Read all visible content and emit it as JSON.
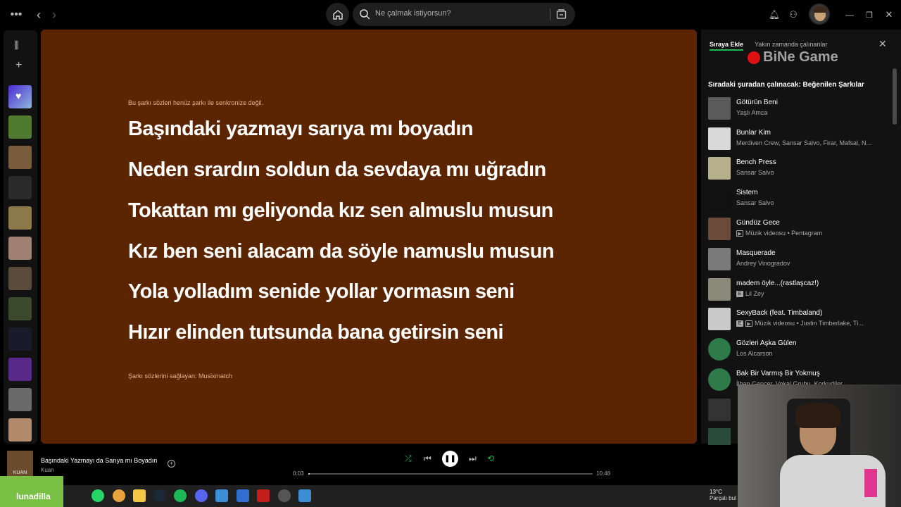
{
  "topbar": {
    "search_placeholder": "Ne çalmak istiyorsun?"
  },
  "lyrics": {
    "sync_note": "Bu şarkı sözleri henüz şarkı ile senkronize değil.",
    "lines": [
      "Başındaki yazmayı sarıya mı boyadın",
      "Neden srardın soldun da sevdaya mı uğradın",
      "Tokattan mı geliyonda kız sen almuslu musun",
      "Kız ben seni alacam da söyle namuslu musun",
      "Yola yolladım senide yollar yormasın seni",
      "Hızır elinden tutsunda bana getirsin seni"
    ],
    "provider": "Şarkı sözlerini sağlayan: Musixmatch",
    "background_color": "#5c2501"
  },
  "queue": {
    "tab_active": "Sıraya Ekle",
    "tab_recent": "Yakın zamanda çalınanlar",
    "watermark": "BiNe Game",
    "heading": "Sıradaki şuradan çalınacak: Beğenilen Şarkılar",
    "items": [
      {
        "title": "Götürün Beni",
        "subtitle": "Yaşlı Amca",
        "badge": "",
        "color": "#5a5a5a"
      },
      {
        "title": "Bunlar Kim",
        "subtitle": "Merdiven Crew, Sansar Salvo, Firar, Mafsal, N...",
        "badge": "",
        "color": "#d9d9d9"
      },
      {
        "title": "Bench Press",
        "subtitle": "Sansar Salvo",
        "badge": "",
        "color": "#b8b08a"
      },
      {
        "title": "Sistem",
        "subtitle": "Sansar Salvo",
        "badge": "",
        "color": "#111111"
      },
      {
        "title": "Gündüz Gece",
        "subtitle": "Müzik videosu • Pentagram",
        "badge": "video",
        "color": "#6b4a3a"
      },
      {
        "title": "Masquerade",
        "subtitle": "Andrey Vinogradov",
        "badge": "",
        "color": "#7a7a7a"
      },
      {
        "title": "madem öyle...(rastlaşcaz!)",
        "subtitle": "Lil Zey",
        "badge": "E",
        "color": "#8a8a7a"
      },
      {
        "title": "SexyBack (feat. Timbaland)",
        "subtitle": "Müzik videosu • Justin Timberlake, Ti...",
        "badge": "E+video",
        "color": "#c9c9c9"
      },
      {
        "title": "Gözleri Aşka Gülen",
        "subtitle": "Los Alcarson",
        "badge": "",
        "color": "#2e7a48"
      },
      {
        "title": "Bak Bir Varmış Bir Yokmuş",
        "subtitle": "İlhan Gencer, Vokal Grubu, Korkudiler...",
        "badge": "",
        "color": "#2e7a48"
      }
    ]
  },
  "player": {
    "thumb_label": "KUAN",
    "track_title": "Başındaki Yazmayı da Sarıya mı Boyadın",
    "artist": "Kuan",
    "elapsed": "0:03",
    "duration": "10:48",
    "progress": 0.005
  },
  "taskbar": {
    "overlay_name": "lunadilla",
    "temperature": "13°C",
    "weather": "Parçalı bul"
  }
}
